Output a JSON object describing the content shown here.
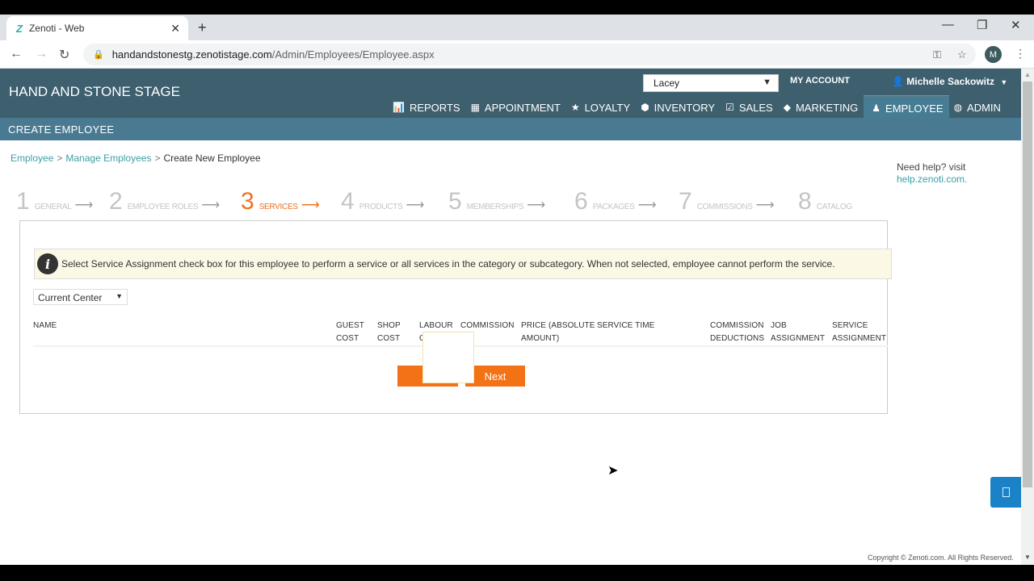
{
  "browser": {
    "tab_title": "Zenoti - Web",
    "tab_favicon": "Z",
    "url_host": "handandstonestg.zenotistage.com",
    "url_path": "/Admin/Employees/Employee.aspx",
    "profile_initial": "M",
    "icons": [
      "back-icon",
      "forward-icon",
      "reload-icon",
      "lock-icon",
      "key-icon",
      "star-icon",
      "menu-icon",
      "minimize-icon",
      "restore-icon",
      "close-icon"
    ]
  },
  "header": {
    "brand": "HAND AND STONE STAGE",
    "location": "Lacey",
    "my_account": "MY ACCOUNT",
    "user_name": "Michelle Sackowitz",
    "nav": [
      {
        "label": "REPORTS",
        "icon": "bar-chart-icon"
      },
      {
        "label": "APPOINTMENT",
        "icon": "calendar-icon"
      },
      {
        "label": "LOYALTY",
        "icon": "star-icon"
      },
      {
        "label": "INVENTORY",
        "icon": "cube-icon"
      },
      {
        "label": "SALES",
        "icon": "checkbox-icon"
      },
      {
        "label": "MARKETING",
        "icon": "tag-icon"
      },
      {
        "label": "EMPLOYEE",
        "icon": "person-icon",
        "active": true
      },
      {
        "label": "ADMIN",
        "icon": "dashboard-icon"
      }
    ],
    "subtitle": "CREATE EMPLOYEE"
  },
  "breadcrumb": {
    "items": [
      "Employee",
      "Manage Employees",
      "Create New Employee"
    ],
    "separator": ">"
  },
  "help": {
    "text": "Need help? visit",
    "link": "help.zenoti.com."
  },
  "wizard": {
    "steps": [
      {
        "num": "1",
        "label": "GENERAL"
      },
      {
        "num": "2",
        "label": "EMPLOYEE ROLES"
      },
      {
        "num": "3",
        "label": "SERVICES",
        "active": true
      },
      {
        "num": "4",
        "label": "PRODUCTS"
      },
      {
        "num": "5",
        "label": "MEMBERSHIPS"
      },
      {
        "num": "6",
        "label": "PACKAGES"
      },
      {
        "num": "7",
        "label": "COMMISSIONS"
      },
      {
        "num": "8",
        "label": "CATALOG"
      }
    ]
  },
  "services": {
    "info_text": "Select Service Assignment check box for this employee to perform a service or all services in the category or subcategory. When not selected, employee cannot perform the service.",
    "center_filter": "Current Center",
    "columns": [
      {
        "l1": "NAME",
        "l2": ""
      },
      {
        "l1": "GUEST",
        "l2": "COST"
      },
      {
        "l1": "SHOP",
        "l2": "COST"
      },
      {
        "l1": "LABOUR",
        "l2": "C"
      },
      {
        "l1": "COMMISSION",
        "l2": ""
      },
      {
        "l1": "PRICE (ABSOLUTE",
        "l2": "AMOUNT)"
      },
      {
        "l1": "SERVICE TIME",
        "l2": ""
      },
      {
        "l1": "COMMISSION",
        "l2": "DEDUCTIONS"
      },
      {
        "l1": "JOB",
        "l2": "ASSIGNMENT"
      },
      {
        "l1": "SERVICE",
        "l2": "ASSIGNMENT"
      }
    ],
    "back_label": "B",
    "next_label": "Next"
  },
  "footer": {
    "copyright": "Copyright © Zenoti.com. All Rights Reserved."
  },
  "colors": {
    "header_bg": "#3d5f6e",
    "subbar_bg": "#4a7a92",
    "accent_orange": "#f47216",
    "link_teal": "#3aa0a8",
    "chat_blue": "#1b82c8"
  }
}
